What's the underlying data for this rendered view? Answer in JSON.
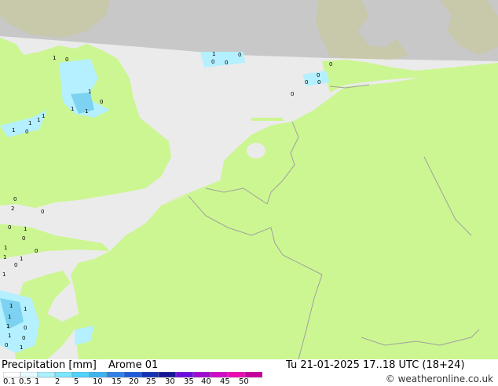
{
  "footer": {
    "title": "Precipitation [mm]",
    "model": "Arome 01",
    "datetime": "Tu 21-01-2025 17..18 UTC (18+24)",
    "credit": "weatheronline.co.uk",
    "copyright_symbol": "©"
  },
  "legend": {
    "ticks": [
      "0.1",
      "0.5",
      "1",
      "2",
      "5",
      "10",
      "15",
      "20",
      "25",
      "30",
      "35",
      "40",
      "45",
      "50"
    ],
    "colors": [
      "#ffffff",
      "#e6fbff",
      "#aaf0ff",
      "#7ce6ff",
      "#50d2fa",
      "#3cb4f0",
      "#3282e6",
      "#1e5adc",
      "#1432b4",
      "#141496",
      "#6c0ce0",
      "#a00ad2",
      "#d209c8",
      "#f008b4",
      "#c8009b"
    ]
  },
  "map": {
    "colors": {
      "sea": "#ebebeb",
      "land_forecast": "#ccf691",
      "land_outside": "#c8c8aa",
      "outside_domain": "#c8c8c8",
      "border": "#a0a0a0",
      "precip_light": "#b4f0ff",
      "precip_mid": "#7cd2f0"
    },
    "precip_labels": [
      "1",
      "0",
      "1",
      "0",
      "0",
      "0",
      "0",
      "1",
      "0",
      "1",
      "1",
      "1",
      "1",
      "0",
      "1",
      "1",
      "0",
      "0",
      "0",
      "2",
      "0",
      "0",
      "0",
      "1",
      "0",
      "1",
      "0",
      "1",
      "0",
      "1",
      "0",
      "1",
      "1",
      "1",
      "1",
      "1",
      "0",
      "1",
      "0",
      "1",
      "0"
    ]
  }
}
